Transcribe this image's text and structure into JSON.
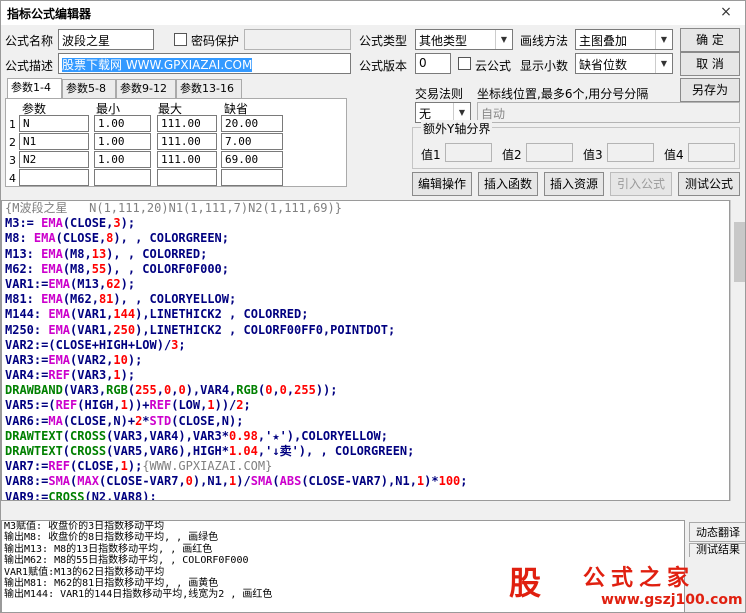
{
  "window": {
    "title": "指标公式编辑器",
    "close": "×"
  },
  "form": {
    "name_label": "公式名称",
    "name_value": "波段之星",
    "password_label": "密码保护",
    "desc_label": "公式描述",
    "desc_value": "股票下载网 WWW.GPXIAZAI.COM",
    "type_label": "公式类型",
    "type_value": "其他类型",
    "draw_label": "画线方法",
    "draw_value": "主图叠加",
    "version_label": "公式版本",
    "version_value": "0",
    "cloud_label": "云公式",
    "decimals_label": "显示小数",
    "decimals_value": "缺省位数"
  },
  "buttons": {
    "ok": "确  定",
    "cancel": "取  消",
    "save_as": "另存为"
  },
  "trade": {
    "label": "交易法则",
    "value": "无",
    "coord_label": "坐标线位置,最多6个,用分号分隔",
    "coord_value": "自动"
  },
  "y_axis": {
    "label": "额外Y轴分界",
    "v1": "值1",
    "v2": "值2",
    "v3": "值3",
    "v4": "值4"
  },
  "tabs": [
    "参数1-4",
    "参数5-8",
    "参数9-12",
    "参数13-16"
  ],
  "params": {
    "headers": [
      "参数",
      "最小",
      "最大",
      "缺省"
    ],
    "rows": [
      {
        "no": "1",
        "name": "N",
        "min": "1.00",
        "max": "111.00",
        "def": "20.00"
      },
      {
        "no": "2",
        "name": "N1",
        "min": "1.00",
        "max": "111.00",
        "def": "7.00"
      },
      {
        "no": "3",
        "name": "N2",
        "min": "1.00",
        "max": "111.00",
        "def": "69.00"
      },
      {
        "no": "4",
        "name": "",
        "min": "",
        "max": "",
        "def": ""
      }
    ]
  },
  "tools": {
    "edit": "编辑操作",
    "insert_func": "插入函数",
    "insert_res": "插入资源",
    "import": "引入公式",
    "test": "测试公式"
  },
  "colors": {
    "keyword": "#0000ff",
    "func": "#cc00cc",
    "number": "#ff0000",
    "draw": "#008000",
    "comment": "#808080",
    "var": "#000080"
  },
  "code": [
    [
      [
        "{M波段之星   N(1,111,20)N1(1,111,7)N2(1,111,69)}",
        "comment"
      ]
    ],
    [
      [
        "M3:= ",
        "var"
      ],
      [
        "EMA",
        "func"
      ],
      [
        "(CLOSE,",
        "var"
      ],
      [
        "3",
        "number"
      ],
      [
        ");",
        "var"
      ]
    ],
    [
      [
        "M8: ",
        "var"
      ],
      [
        "EMA",
        "func"
      ],
      [
        "(CLOSE,",
        "var"
      ],
      [
        "8",
        "number"
      ],
      [
        "), , COLORGREEN;",
        "var"
      ]
    ],
    [
      [
        "M13: ",
        "var"
      ],
      [
        "EMA",
        "func"
      ],
      [
        "(M8,",
        "var"
      ],
      [
        "13",
        "number"
      ],
      [
        "), , COLORRED;",
        "var"
      ]
    ],
    [
      [
        "M62: ",
        "var"
      ],
      [
        "EMA",
        "func"
      ],
      [
        "(M8,",
        "var"
      ],
      [
        "55",
        "number"
      ],
      [
        "), , COLORF0F000;",
        "var"
      ]
    ],
    [
      [
        "VAR1:=",
        "var"
      ],
      [
        "EMA",
        "func"
      ],
      [
        "(M13,",
        "var"
      ],
      [
        "62",
        "number"
      ],
      [
        ");",
        "var"
      ]
    ],
    [
      [
        "M81: ",
        "var"
      ],
      [
        "EMA",
        "func"
      ],
      [
        "(M62,",
        "var"
      ],
      [
        "81",
        "number"
      ],
      [
        "), , COLORYELLOW;",
        "var"
      ]
    ],
    [
      [
        "M144: ",
        "var"
      ],
      [
        "EMA",
        "func"
      ],
      [
        "(VAR1,",
        "var"
      ],
      [
        "144",
        "number"
      ],
      [
        "),LINETHICK2 , COLORRED;",
        "var"
      ]
    ],
    [
      [
        "M250: ",
        "var"
      ],
      [
        "EMA",
        "func"
      ],
      [
        "(VAR1,",
        "var"
      ],
      [
        "250",
        "number"
      ],
      [
        "),LINETHICK2 , COLORF00FF0,POINTDOT;",
        "var"
      ]
    ],
    [
      [
        "VAR2:=(CLOSE+HIGH+LOW)/",
        "var"
      ],
      [
        "3",
        "number"
      ],
      [
        ";",
        "var"
      ]
    ],
    [
      [
        "VAR3:=",
        "var"
      ],
      [
        "EMA",
        "func"
      ],
      [
        "(VAR2,",
        "var"
      ],
      [
        "10",
        "number"
      ],
      [
        ");",
        "var"
      ]
    ],
    [
      [
        "VAR4:=",
        "var"
      ],
      [
        "REF",
        "func"
      ],
      [
        "(VAR3,",
        "var"
      ],
      [
        "1",
        "number"
      ],
      [
        ");",
        "var"
      ]
    ],
    [
      [
        "DRAWBAND",
        "draw"
      ],
      [
        "(VAR3,",
        "var"
      ],
      [
        "RGB",
        "draw"
      ],
      [
        "(",
        "var"
      ],
      [
        "255",
        "number"
      ],
      [
        ",",
        "var"
      ],
      [
        "0",
        "number"
      ],
      [
        ",",
        "var"
      ],
      [
        "0",
        "number"
      ],
      [
        "),VAR4,",
        "var"
      ],
      [
        "RGB",
        "draw"
      ],
      [
        "(",
        "var"
      ],
      [
        "0",
        "number"
      ],
      [
        ",",
        "var"
      ],
      [
        "0",
        "number"
      ],
      [
        ",",
        "var"
      ],
      [
        "255",
        "number"
      ],
      [
        "));",
        "var"
      ]
    ],
    [
      [
        "VAR5:=(",
        "var"
      ],
      [
        "REF",
        "func"
      ],
      [
        "(HIGH,",
        "var"
      ],
      [
        "1",
        "number"
      ],
      [
        "))+",
        "var"
      ],
      [
        "REF",
        "func"
      ],
      [
        "(LOW,",
        "var"
      ],
      [
        "1",
        "number"
      ],
      [
        "))/",
        "var"
      ],
      [
        "2",
        "number"
      ],
      [
        ";",
        "var"
      ]
    ],
    [
      [
        "VAR6:=",
        "var"
      ],
      [
        "MA",
        "func"
      ],
      [
        "(CLOSE,N)+",
        "var"
      ],
      [
        "2",
        "number"
      ],
      [
        "*",
        "var"
      ],
      [
        "STD",
        "func"
      ],
      [
        "(CLOSE,N);",
        "var"
      ]
    ],
    [
      [
        "DRAWTEXT",
        "draw"
      ],
      [
        "(",
        "var"
      ],
      [
        "CROSS",
        "draw"
      ],
      [
        "(VAR3,VAR4),VAR3*",
        "var"
      ],
      [
        "0.98",
        "number"
      ],
      [
        ",'★'),COLORYELLOW;",
        "var"
      ]
    ],
    [
      [
        "DRAWTEXT",
        "draw"
      ],
      [
        "(",
        "var"
      ],
      [
        "CROSS",
        "draw"
      ],
      [
        "(VAR5,VAR6),HIGH*",
        "var"
      ],
      [
        "1.04",
        "number"
      ],
      [
        ",'↓卖'), , COLORGREEN;",
        "var"
      ]
    ],
    [
      [
        "VAR7:=",
        "var"
      ],
      [
        "REF",
        "func"
      ],
      [
        "(CLOSE,",
        "var"
      ],
      [
        "1",
        "number"
      ],
      [
        ");",
        "var"
      ],
      [
        "{WWW.GPXIAZAI.COM}",
        "comment"
      ]
    ],
    [
      [
        "VAR8:=",
        "var"
      ],
      [
        "SMA",
        "func"
      ],
      [
        "(",
        "var"
      ],
      [
        "MAX",
        "func"
      ],
      [
        "(CLOSE-VAR7,",
        "var"
      ],
      [
        "0",
        "number"
      ],
      [
        "),N1,",
        "var"
      ],
      [
        "1",
        "number"
      ],
      [
        ")/",
        "var"
      ],
      [
        "SMA",
        "func"
      ],
      [
        "(",
        "var"
      ],
      [
        "ABS",
        "func"
      ],
      [
        "(CLOSE-VAR7),N1,",
        "var"
      ],
      [
        "1",
        "number"
      ],
      [
        ")*",
        "var"
      ],
      [
        "100",
        "number"
      ],
      [
        ";",
        "var"
      ]
    ],
    [
      [
        "VAR9:=",
        "var"
      ],
      [
        "CROSS",
        "draw"
      ],
      [
        "(N2,VAR8);",
        "var"
      ]
    ]
  ],
  "output": [
    "M3赋值: 收盘价的3日指数移动平均",
    "输出M8: 收盘价的8日指数移动平均, , 画绿色",
    "输出M13: M8的13日指数移动平均, , 画红色",
    "输出M62: M8的55日指数移动平均, , COLORF0F000",
    "VAR1赋值:M13的62日指数移动平均",
    "输出M81: M62的81日指数移动平均, , 画黄色",
    "输出M144: VAR1的144日指数移动平均,线宽为2 , 画红色"
  ],
  "side": {
    "translate": "动态翻译",
    "test_result": "测试结果"
  },
  "watermark": {
    "char": "股",
    "text": "公式之家",
    "url": "www.gszj100.com"
  }
}
